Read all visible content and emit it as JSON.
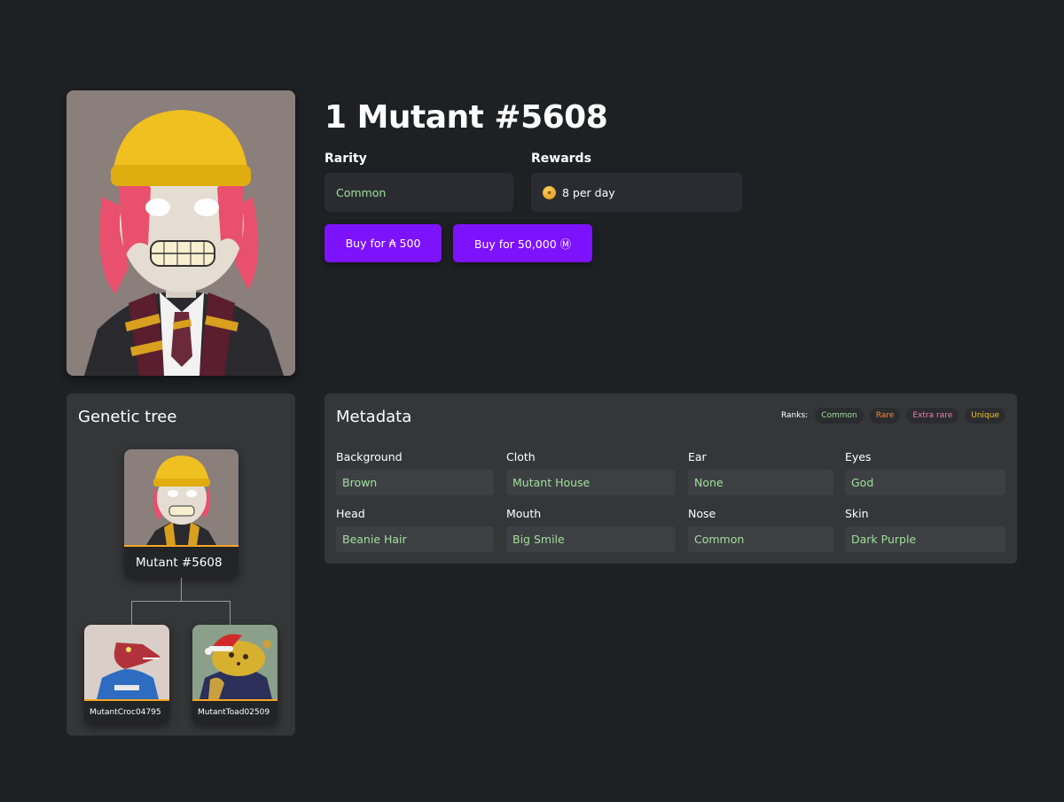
{
  "nft": {
    "title": "1 Mutant #5608",
    "rarity_label": "Rarity",
    "rarity_value": "Common",
    "rewards_label": "Rewards",
    "rewards_value": "8 per day",
    "buy_ada_label": "Buy for ₳ 500",
    "buy_token_label": "Buy for 50,000 Ⓜ"
  },
  "genetic_tree": {
    "title": "Genetic tree",
    "main_name": "Mutant #5608",
    "parent_1_name": "MutantCroc04795",
    "parent_2_name": "MutantToad02509"
  },
  "metadata": {
    "title": "Metadata",
    "ranks_label": "Ranks:",
    "ranks": [
      {
        "label": "Common",
        "color": "#9fe29b"
      },
      {
        "label": "Rare",
        "color": "#f0883e"
      },
      {
        "label": "Extra rare",
        "color": "#f57ab0"
      },
      {
        "label": "Unique",
        "color": "#f5c518"
      }
    ],
    "attributes": [
      {
        "label": "Background",
        "value": "Brown"
      },
      {
        "label": "Cloth",
        "value": "Mutant House"
      },
      {
        "label": "Ear",
        "value": "None"
      },
      {
        "label": "Eyes",
        "value": "God"
      },
      {
        "label": "Head",
        "value": "Beanie Hair"
      },
      {
        "label": "Mouth",
        "value": "Big Smile"
      },
      {
        "label": "Nose",
        "value": "Common"
      },
      {
        "label": "Skin",
        "value": "Dark Purple"
      }
    ]
  },
  "colors": {
    "background": "#1f2024",
    "panel": "#353638",
    "accent_button": "#7d12ff",
    "common_green": "#9fe29b",
    "card_border": "#f5a524"
  },
  "icons": {
    "coin": "reward-coin-icon"
  }
}
